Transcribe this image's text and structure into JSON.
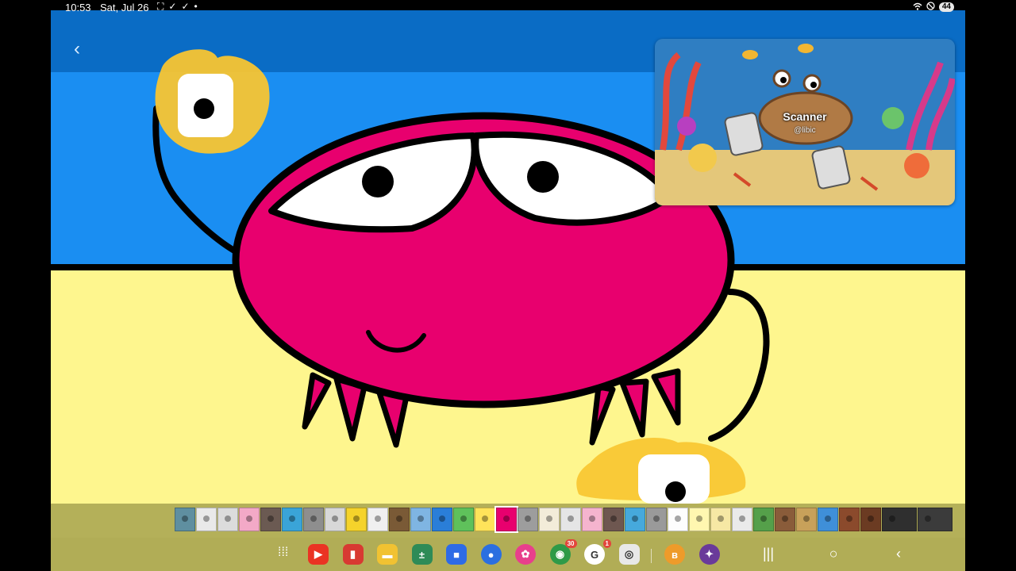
{
  "status_bar": {
    "time": "10:53",
    "date": "Sat, Jul 26",
    "battery": "44",
    "left_icons": [
      "screenshot-icon",
      "check-icon",
      "check-icon",
      "dot-icon"
    ],
    "right_icons": [
      "wifi-icon",
      "do-not-disturb-icon"
    ]
  },
  "toolbar": {
    "back_icon": "chevron-left-icon"
  },
  "video_card": {
    "title": "Scanner",
    "author": "@libic"
  },
  "colors": {
    "top_bar": "#0a6cc5",
    "sky": "#1a8ef2",
    "sand": "#fef68e",
    "crab_body": "#e8006e",
    "eye_blob": "#f8c531",
    "strip": "#b4b059"
  },
  "thumbnails": [
    {
      "color": "#5f8fa0"
    },
    {
      "color": "#e9e9e9"
    },
    {
      "color": "#dcdcdc"
    },
    {
      "color": "#f3a9c7"
    },
    {
      "color": "#6b5a52"
    },
    {
      "color": "#3aa4d8"
    },
    {
      "color": "#8e8e8e"
    },
    {
      "color": "#d8d8d8"
    },
    {
      "color": "#f5d32b"
    },
    {
      "color": "#f0f0f0"
    },
    {
      "color": "#7a5a36"
    },
    {
      "color": "#7fb5e2"
    },
    {
      "color": "#2a7ed8"
    },
    {
      "color": "#5fc15b"
    },
    {
      "color": "#ffe35a"
    },
    {
      "color": "#e8006e",
      "selected": true
    },
    {
      "color": "#9d9d9d"
    },
    {
      "color": "#f3ecd9"
    },
    {
      "color": "#e5e5e5"
    },
    {
      "color": "#f5b4ce"
    },
    {
      "color": "#6e5750"
    },
    {
      "color": "#46a9dc"
    },
    {
      "color": "#9a9a9a"
    },
    {
      "color": "#fdfdfd"
    },
    {
      "color": "#fff7b0"
    },
    {
      "color": "#f6e8a4"
    },
    {
      "color": "#eaeaea"
    },
    {
      "color": "#55a04a"
    },
    {
      "color": "#8a5c3a"
    },
    {
      "color": "#c8a15a"
    },
    {
      "color": "#3f8fd8"
    },
    {
      "color": "#8b4a2c"
    },
    {
      "color": "#6b3b22"
    },
    {
      "color": "#2f2f2f",
      "wide": true
    },
    {
      "color": "#3b3b3b",
      "wide": true
    }
  ],
  "dock": {
    "apps": [
      {
        "name": "youtube-app",
        "glyph": "▶",
        "color": "#ea3323",
        "round": false
      },
      {
        "name": "notes-app",
        "glyph": "▮",
        "color": "#d83a32",
        "round": false
      },
      {
        "name": "files-app",
        "glyph": "▬",
        "color": "#f1c232",
        "round": false
      },
      {
        "name": "calculator-app",
        "glyph": "±",
        "color": "#2e8b57",
        "round": false
      },
      {
        "name": "roblox-app",
        "glyph": "■",
        "color": "#2e6be6",
        "round": false
      },
      {
        "name": "messages-app",
        "glyph": "●",
        "color": "#2b6fe0",
        "round": true
      },
      {
        "name": "gallery-app",
        "glyph": "✿",
        "color": "#e83f8c",
        "round": true
      },
      {
        "name": "chrome-app",
        "glyph": "◉",
        "color": "#2f9a48",
        "round": true,
        "badge": "30"
      },
      {
        "name": "google-app",
        "glyph": "G",
        "color": "#ffffff",
        "round": true,
        "badge": "1"
      },
      {
        "name": "camera-app",
        "glyph": "◎",
        "color": "#e8e8e8",
        "round": false
      },
      {
        "name": "bixby-app",
        "glyph": "ʙ",
        "color": "#ee9b2a",
        "round": true
      },
      {
        "name": "game-app",
        "glyph": "✦",
        "color": "#6a3a9a",
        "round": true
      }
    ],
    "nav_recents": "|||",
    "nav_home": "○",
    "nav_back": "‹"
  }
}
